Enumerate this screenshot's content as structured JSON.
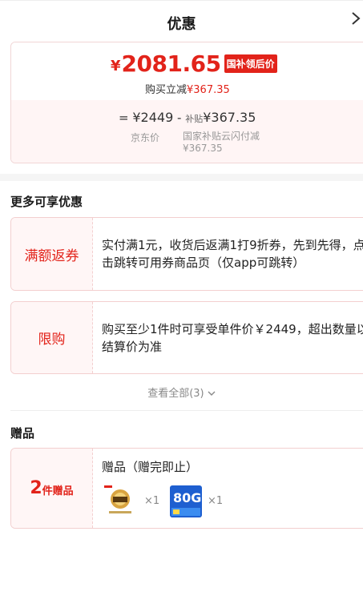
{
  "header": {
    "title": "优惠",
    "close_icon": "chevron-right-icon"
  },
  "price": {
    "currency": "¥",
    "final": "2081.65",
    "tag": "国补领后价",
    "reduce_label": "购买立减",
    "reduce_amount": "¥367.35",
    "eq": "=",
    "jd_price": "¥2449",
    "minus": "-",
    "subsidy_small": "补贴",
    "subsidy_amount": "¥367.35",
    "jd_label": "京东价",
    "subsidy_label": "国家补贴云闪付减",
    "subsidy_label_amount": "¥367.35"
  },
  "more_offers": {
    "title": "更多可享优惠",
    "items": [
      {
        "tag": "满额返券",
        "text": "实付满1元，收货后返满1打9折券，先到先得，点击跳转可用券商品页（仅app可跳转）"
      },
      {
        "tag": "限购",
        "text": "购买至少1件时可享受单件价￥2449，超出数量以结算价为准"
      }
    ],
    "view_all": "查看全部(3)",
    "view_all_icon": "chevron-down-icon"
  },
  "gifts": {
    "title": "赠品",
    "count": "2",
    "count_unit": "件赠品",
    "subtitle": "赠品（赠完即止）",
    "items": [
      {
        "name": "gift-badge-image",
        "qty": "×1"
      },
      {
        "name": "gift-data-card-image",
        "label": "80G",
        "qty": "×1"
      }
    ]
  },
  "colors": {
    "accent": "#e2231a",
    "soft_bg": "#fff5f5",
    "border": "#f3cfcf"
  }
}
